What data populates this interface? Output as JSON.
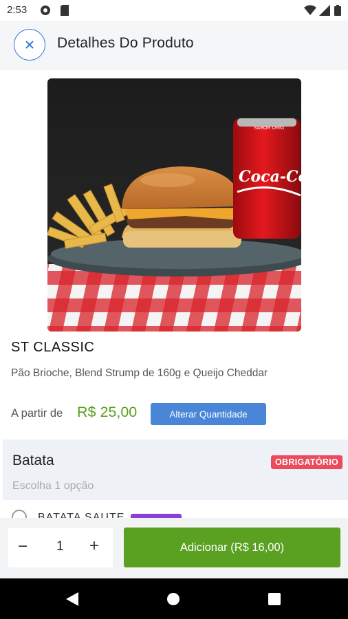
{
  "status_bar": {
    "time": "2:53",
    "icons": [
      "vpn-icon",
      "sim-icon",
      "wifi-icon",
      "signal-icon",
      "battery-icon"
    ]
  },
  "header": {
    "close_icon": "close-icon",
    "title": "Detalhes Do Produto"
  },
  "product": {
    "image_alt": "burger-fries-soda-photo",
    "name": "ST CLASSIC",
    "description": "Pão Brioche, Blend Strump de 160g e Queijo Cheddar",
    "price_prefix": "A partir de",
    "price": "R$ 25,00",
    "change_quantity_label": "Alterar Quantidade"
  },
  "option_group": {
    "title": "Batata",
    "required_badge": "OBRIGATÓRIO",
    "subtitle": "Escolha 1 opção",
    "first_item_label": "BATATA SAUTE"
  },
  "bottom_bar": {
    "minus": "−",
    "quantity": "1",
    "plus": "+",
    "add_label": "Adicionar (R$ 16,00)"
  },
  "colors": {
    "accent_blue": "#4a86d8",
    "price_green": "#5aa021",
    "required_red": "#ea4b5d",
    "badge_purple": "#8b3fd9"
  }
}
